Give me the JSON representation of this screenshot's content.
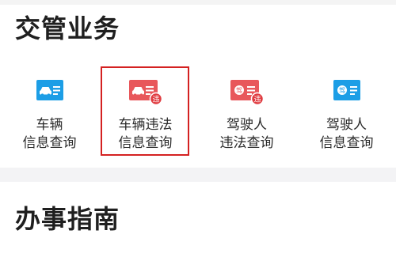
{
  "sections": [
    {
      "title": "交管业务"
    },
    {
      "title": "办事指南"
    }
  ],
  "services": [
    {
      "line1": "车辆",
      "line2": "信息查询",
      "icon": "car-card-icon",
      "color": "#1c9ee6"
    },
    {
      "line1": "车辆违法",
      "line2": "信息查询",
      "icon": "car-violation-icon",
      "color": "#e8575b",
      "badge": "违"
    },
    {
      "line1": "驾驶人",
      "line2": "违法查询",
      "icon": "driver-violation-icon",
      "color": "#e8575b",
      "badge": "违",
      "glyph": "驾"
    },
    {
      "line1": "驾驶人",
      "line2": "信息查询",
      "icon": "driver-card-icon",
      "color": "#1c9ee6",
      "glyph": "驾"
    }
  ],
  "selected_index": 1,
  "colors": {
    "selection_border": "#d42121",
    "blue": "#1c9ee6",
    "red": "#e8575b"
  }
}
